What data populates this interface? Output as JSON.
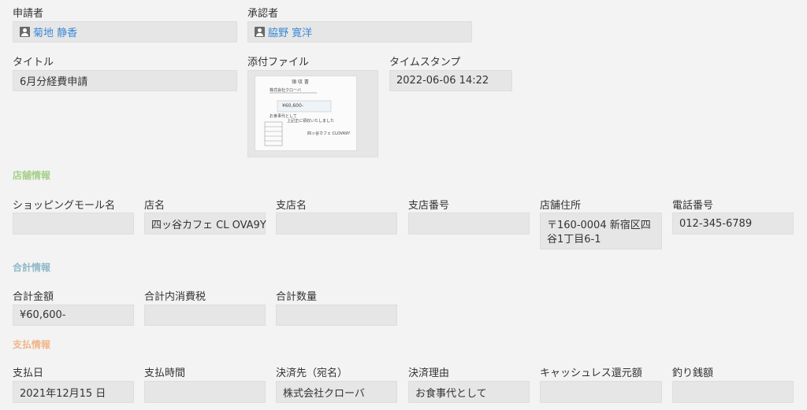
{
  "header": {
    "applicant_label": "申請者",
    "applicant_name": "菊地 静香",
    "approver_label": "承認者",
    "approver_name": "脇野 寛洋",
    "title_label": "タイトル",
    "title_value": "6月分経費申請",
    "attachment_label": "添付ファイル",
    "timestamp_label": "タイムスタンプ",
    "timestamp_value": "2022-06-06 14:22"
  },
  "receipt": {
    "heading": "領 収 書",
    "recipient": "株式会社クローバ",
    "amount": "¥60,600-",
    "purpose": "お食事代として",
    "confirm": "上記正に領収いたしました",
    "store": "四ッ谷カフェ CLOVA9Y"
  },
  "store_section": {
    "title": "店舗情報",
    "color": "#a6cf8a",
    "fields": [
      {
        "label": "ショッピングモール名",
        "value": ""
      },
      {
        "label": "店名",
        "value": "四ッ谷カフェ CL OVA9Y"
      },
      {
        "label": "支店名",
        "value": ""
      },
      {
        "label": "支店番号",
        "value": ""
      },
      {
        "label": "店舗住所",
        "value": "〒160-0004 新宿区四谷1丁目6-1"
      },
      {
        "label": "電話番号",
        "value": "012-345-6789"
      }
    ]
  },
  "total_section": {
    "title": "合計情報",
    "color": "#8fb8c9",
    "fields": [
      {
        "label": "合計金額",
        "value": "¥60,600-"
      },
      {
        "label": "合計内消費税",
        "value": ""
      },
      {
        "label": "合計数量",
        "value": ""
      }
    ]
  },
  "payment_section": {
    "title": "支払情報",
    "color": "#f2b58a",
    "fields": [
      {
        "label": "支払日",
        "value": "2021年12月15 日"
      },
      {
        "label": "支払時間",
        "value": ""
      },
      {
        "label": "決済先（宛名）",
        "value": "株式会社クローバ"
      },
      {
        "label": "決済理由",
        "value": "お食事代として"
      },
      {
        "label": "キャッシュレス還元額",
        "value": ""
      },
      {
        "label": "釣り銭額",
        "value": ""
      }
    ]
  }
}
